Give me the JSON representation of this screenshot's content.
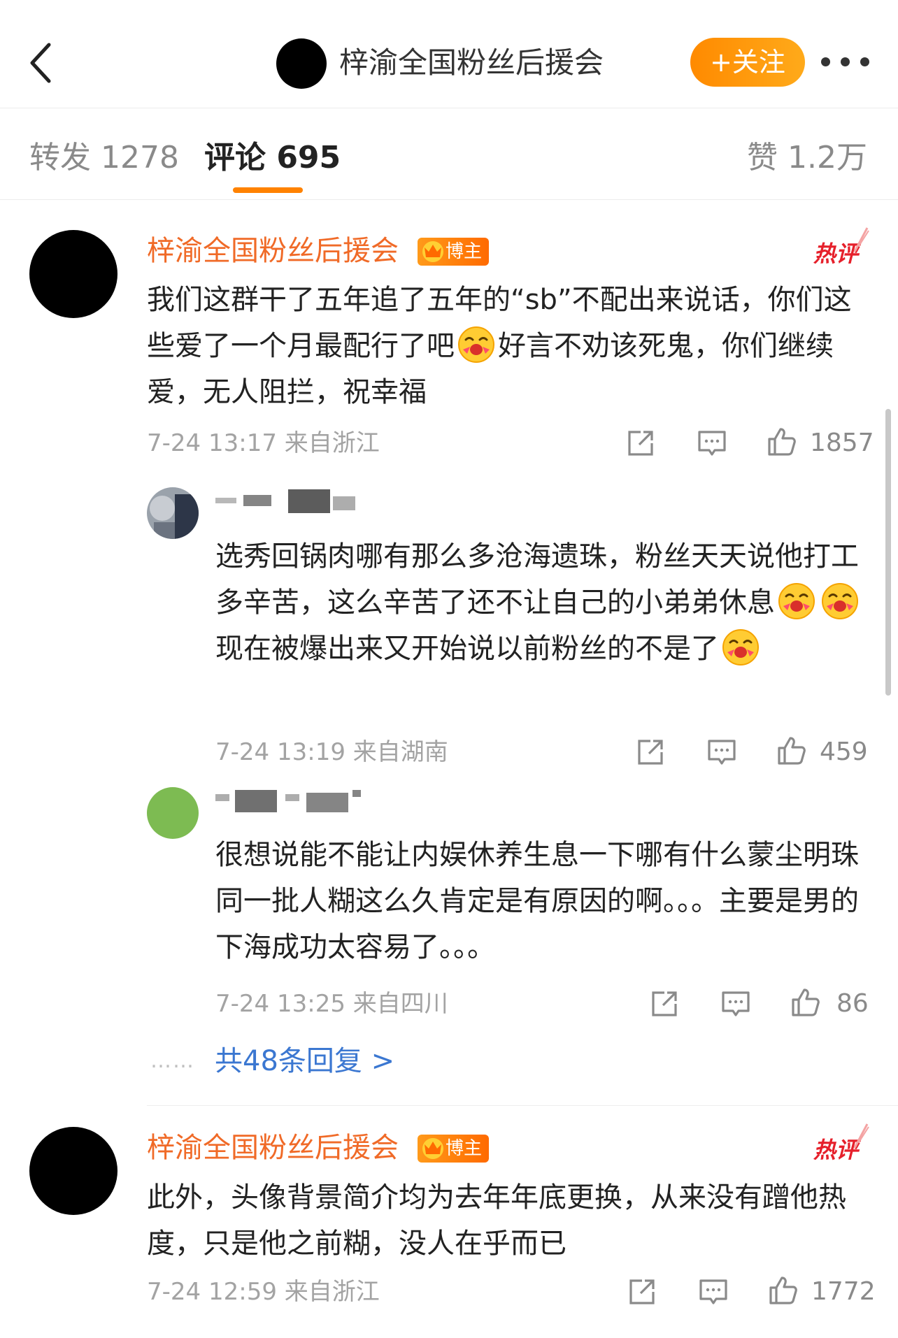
{
  "header": {
    "title": "梓渝全国粉丝后援会",
    "follow_label": "+关注"
  },
  "tabs": {
    "repost": "转发 1278",
    "comments": "评论 695",
    "likes": "赞 1.2万"
  },
  "colors": {
    "accent": "#ff8200",
    "username": "#f06a27",
    "link": "#3b77d1",
    "hot": "#e6202b"
  },
  "comments": [
    {
      "username": "梓渝全国粉丝后援会",
      "badge": "博主",
      "hot": "热评",
      "text_1": "我们这群干了五年追了五年的“sb”不配出来说话，你们这些爱了一个月最配行了吧",
      "text_2": "好言不劝该死鬼，你们继续爱，无人阻拦，祝幸福",
      "time": "7-24 13:17",
      "location": "来自浙江",
      "likes": "1857"
    },
    {
      "username": "梓渝全国粉丝后援会",
      "badge": "博主",
      "hot": "热评",
      "text": "此外，头像背景简介均为去年年底更换，从来没有蹭他热度，只是他之前糊，没人在乎而已",
      "time": "7-24 12:59",
      "location": "来自浙江",
      "likes": "1772"
    }
  ],
  "replies": [
    {
      "text_1": "选秀回锅肉哪有那么多沧海遗珠，粉丝天天说他打工多辛苦，这么辛苦了还不让自己的小弟弟休息",
      "text_2": "现在被爆出来又开始说以前粉丝的不是了",
      "time": "7-24 13:19",
      "location": "来自湖南",
      "likes": "459"
    },
    {
      "text": "很想说能不能让内娱休养生息一下哪有什么蒙尘明珠 同一批人糊这么久肯定是有原因的啊。。。主要是男的下海成功太容易了。。。",
      "time": "7-24 13:25",
      "location": "来自四川",
      "likes": "86"
    }
  ],
  "more_replies": {
    "dots": "……",
    "label": "共48条回复 >"
  }
}
